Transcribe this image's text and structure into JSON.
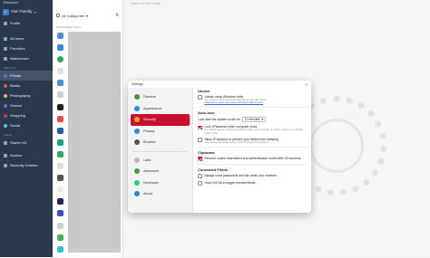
{
  "app": {
    "title": "1Password"
  },
  "sidebar": {
    "vault": {
      "name": "Our Family",
      "initial": "F"
    },
    "profile": "Profile",
    "all_items": "All Items",
    "favorites": "Favorites",
    "watchtower": "Watchtower",
    "vaults_header": "VAULTS",
    "vaults": [
      "Private",
      "Banks",
      "Photography",
      "Shared",
      "Shopping",
      "Social"
    ],
    "tags_header": "TAGS",
    "tags": [
      "Starter Kit"
    ],
    "archive": "Archive",
    "recently_deleted": "Recently Deleted"
  },
  "list": {
    "category": "All Categories",
    "month": "NOVEMBER 2023"
  },
  "search": {
    "placeholder": "Search in Our Family"
  },
  "dialog": {
    "title": "Settings",
    "nav": [
      "General",
      "Appearance",
      "Security",
      "Privacy",
      "Browser",
      "Labs",
      "Advanced",
      "Developer",
      "About"
    ],
    "selected_nav": "Security",
    "unlock": {
      "title": "Unlock",
      "windows_hello": "Unlock using Windows Hello",
      "windows_hello_sub": "You need to set up Windows Hello before you can unlock",
      "windows_hello_link": "1Password. Learn more about Windows Hello security"
    },
    "autolock": {
      "title": "Auto-lock",
      "lock_after": "Lock after the system is idle for",
      "minutes": "10 minutes",
      "lock_on_lock": "Lock 1Password when computer locks",
      "lock_on_lock_sub": "For added security, 1Password will lock when your computer is locked, sleeps, or is left idle. Learn more.",
      "allow_sleep": "Allow 1Password to prevent your device from sleeping",
      "allow_sleep_sub": "Your device will remain active while 1Password is unlocked."
    },
    "clipboard": {
      "title": "Clipboard",
      "remove": "Remove copied information and authentication codes after 90 seconds"
    },
    "concealed": {
      "title": "Concealed Fields",
      "always_show": "Always show passwords and full credit card numbers",
      "hold_ctrl": "Hold Ctrl+Alt to toggle revealed fields"
    }
  }
}
